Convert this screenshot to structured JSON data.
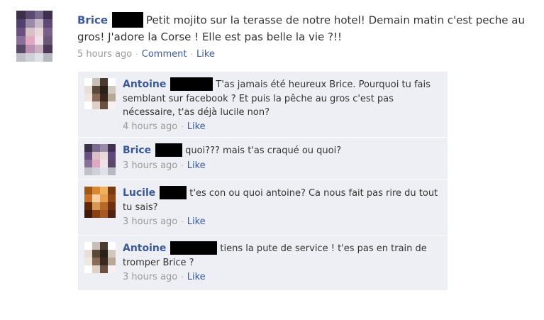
{
  "post": {
    "author": "Brice",
    "text": "Petit mojito sur la terasse de notre hotel! Demain matin c'est peche au gros! J'adore la Corse ! Elle est pas belle la vie ?!!",
    "time": "5 hours ago",
    "comment_label": "Comment",
    "like_label": "Like",
    "separator": "·"
  },
  "comments": [
    {
      "author": "Antoine",
      "text": "T'as jamais été heureux Brice. Pourquoi tu fais semblant sur facebook ? Et puis la pêche au gros c'est pas nécessaire, t'as déjà lucile non?",
      "time": "4 hours ago",
      "like_label": "Like"
    },
    {
      "author": "Brice",
      "text": "quoi??? mais t'as craqué ou quoi?",
      "time": "3 hours ago",
      "like_label": "Like"
    },
    {
      "author": "Lucile",
      "text": "t'es con ou quoi antoine? Ca nous fait pas rire du tout tu sais?",
      "time": "3 hours ago",
      "like_label": "Like"
    },
    {
      "author": "Antoine",
      "text": "tiens la pute de service ! t'es pas en train de tromper Brice ?",
      "time": "3 hours ago",
      "like_label": "Like"
    }
  ],
  "colors": {
    "link": "#3b5998",
    "meta": "#999999",
    "comment_bg": "#edeff4",
    "redaction": "#000000"
  }
}
